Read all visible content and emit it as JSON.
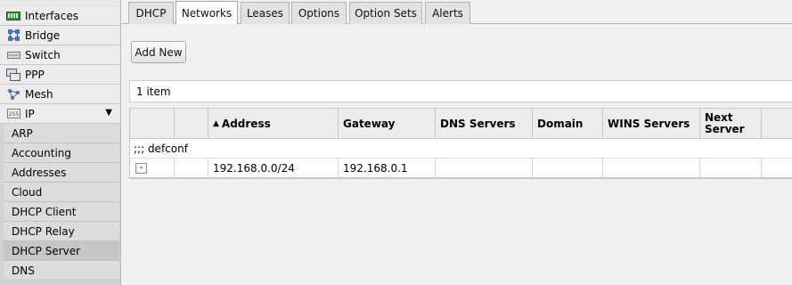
{
  "sidebar": {
    "items": [
      {
        "label": "Interfaces",
        "icon": "interfaces-icon"
      },
      {
        "label": "Bridge",
        "icon": "bridge-icon"
      },
      {
        "label": "Switch",
        "icon": "switch-icon"
      },
      {
        "label": "PPP",
        "icon": "ppp-icon"
      },
      {
        "label": "Mesh",
        "icon": "mesh-icon"
      },
      {
        "label": "IP",
        "icon": "ip-icon",
        "arrow": "▼"
      }
    ],
    "sub_items": [
      {
        "label": "ARP"
      },
      {
        "label": "Accounting"
      },
      {
        "label": "Addresses"
      },
      {
        "label": "Cloud"
      },
      {
        "label": "DHCP Client"
      },
      {
        "label": "DHCP Relay"
      },
      {
        "label": "DHCP Server"
      },
      {
        "label": "DNS"
      }
    ],
    "active_sub_item": "DHCP Server"
  },
  "tabs": [
    {
      "label": "DHCP"
    },
    {
      "label": "Networks"
    },
    {
      "label": "Leases"
    },
    {
      "label": "Options"
    },
    {
      "label": "Option Sets"
    },
    {
      "label": "Alerts"
    }
  ],
  "active_tab": "Networks",
  "toolbar": {
    "add_new_label": "Add New"
  },
  "count_label": "1 item",
  "table": {
    "sort_indicator": "▲",
    "columns": [
      "",
      "",
      "Address",
      "Gateway",
      "DNS Servers",
      "Domain",
      "WINS Servers",
      "Next Server"
    ],
    "comment": ";;; defconf",
    "rows": [
      {
        "remove": "-",
        "flag": "",
        "address": "192.168.0.0/24",
        "gateway": "192.168.0.1",
        "dns_servers": "",
        "domain": "",
        "wins_servers": "",
        "next_server": ""
      }
    ]
  }
}
